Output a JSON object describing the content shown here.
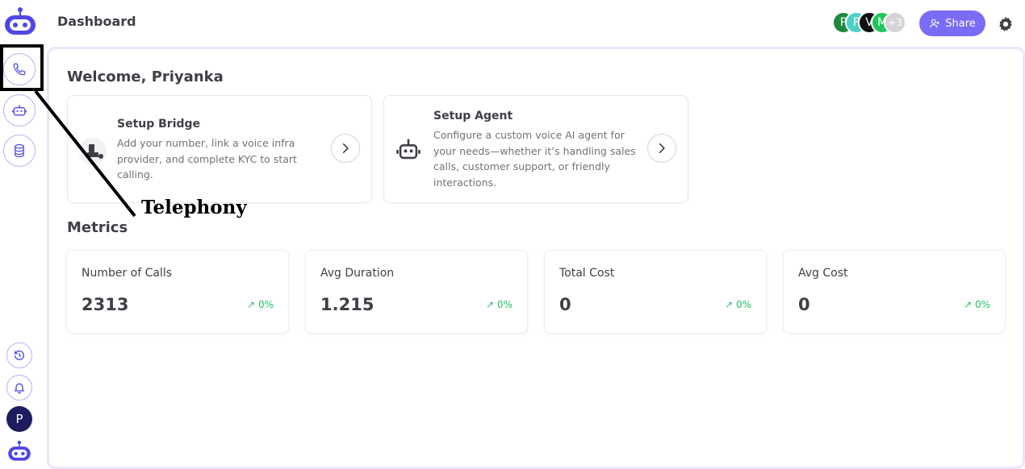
{
  "header": {
    "title": "Dashboard",
    "share_label": "Share",
    "collaborators": [
      {
        "initial": "P",
        "color": "#1f8a3b"
      },
      {
        "initial": "P",
        "color": "#4fd1c5"
      },
      {
        "initial": "V",
        "color": "#111111"
      },
      {
        "initial": "M",
        "color": "#22c55e"
      },
      {
        "initial": "+3",
        "color": "#d4d4d8"
      }
    ]
  },
  "sidebar": {
    "items": [
      {
        "name": "telephony",
        "icon": "phone-icon"
      },
      {
        "name": "agents",
        "icon": "robot-icon"
      },
      {
        "name": "database",
        "icon": "database-icon"
      }
    ],
    "bottom": [
      {
        "name": "history",
        "icon": "history-icon"
      },
      {
        "name": "notifications",
        "icon": "bell-icon"
      }
    ],
    "user_initial": "P"
  },
  "main": {
    "welcome": "Welcome, Priyanka",
    "cards": [
      {
        "title": "Setup Bridge",
        "description": "Add your number, link a voice infra provider, and complete KYC to start calling.",
        "icon": "bridge-icon"
      },
      {
        "title": "Setup Agent",
        "description": "Configure a custom voice AI agent for your needs—whether it’s handling sales calls, customer support, or friendly interactions.",
        "icon": "robot-icon"
      }
    ],
    "metrics_title": "Metrics",
    "metrics": [
      {
        "label": "Number of Calls",
        "value": "2313",
        "change": "0%"
      },
      {
        "label": "Avg Duration",
        "value": "1.215",
        "change": "0%"
      },
      {
        "label": "Total Cost",
        "value": "0",
        "change": "0%"
      },
      {
        "label": "Avg Cost",
        "value": "0",
        "change": "0%"
      }
    ]
  },
  "annotation": {
    "label": "Telephony"
  },
  "colors": {
    "accent": "#7b6cf6",
    "positive": "#22c55e",
    "panel_border": "#ede4fb"
  }
}
